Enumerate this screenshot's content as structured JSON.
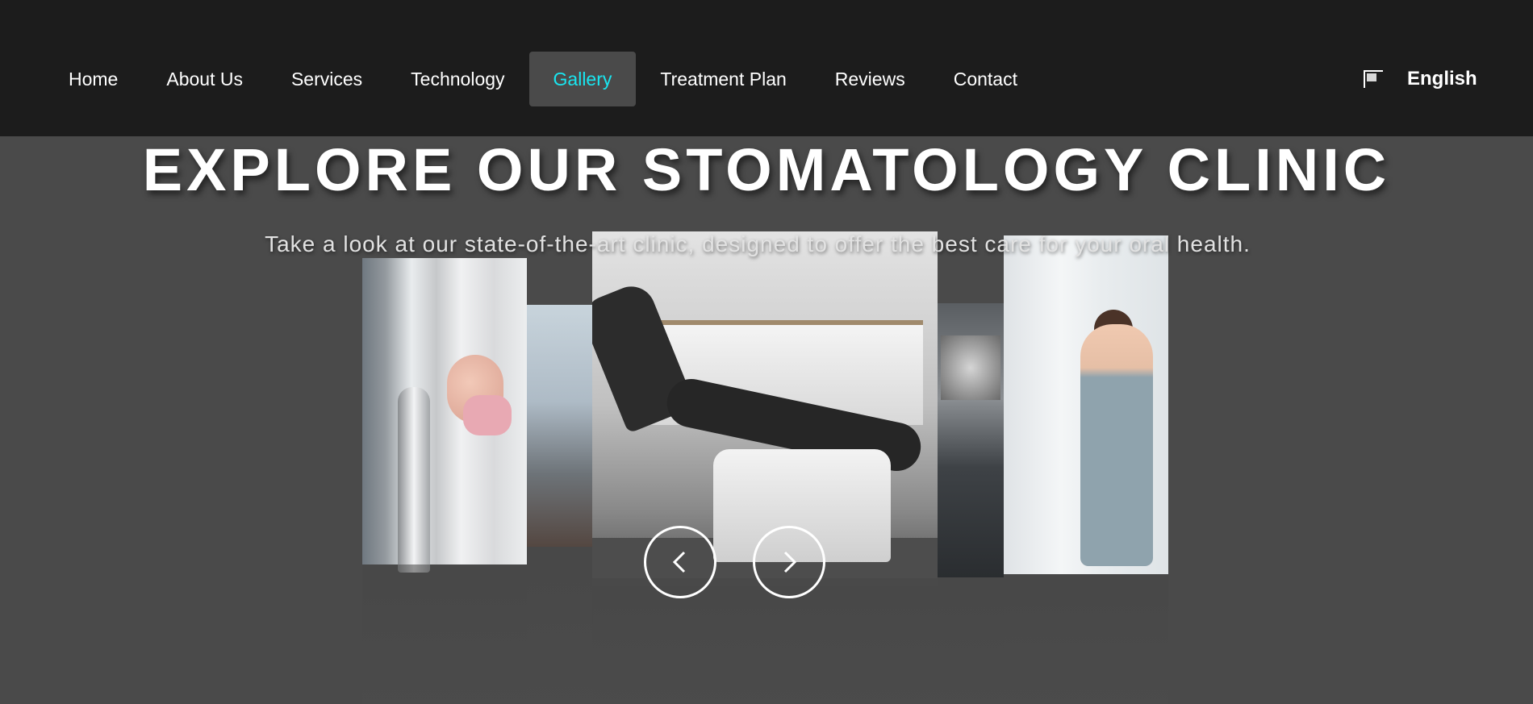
{
  "nav": {
    "items": [
      {
        "label": "Home"
      },
      {
        "label": "About Us"
      },
      {
        "label": "Services"
      },
      {
        "label": "Technology"
      },
      {
        "label": "Gallery",
        "active": true
      },
      {
        "label": "Treatment Plan"
      },
      {
        "label": "Reviews"
      },
      {
        "label": "Contact"
      }
    ],
    "language": {
      "label": "English",
      "icon": "flag-icon"
    }
  },
  "hero": {
    "title": "EXPLORE OUR STOMATOLOGY CLINIC",
    "subtitle": "Take a look at our state-of-the-art clinic, designed to offer the best care for your oral health."
  },
  "carousel": {
    "slides": [
      {
        "name": "dental-equipment-child-photo"
      },
      {
        "name": "dental-light-photo"
      },
      {
        "name": "dental-chair-photo"
      },
      {
        "name": "xray-monitor-photo"
      },
      {
        "name": "dentist-holding-model-photo"
      }
    ],
    "prev_icon": "chevron-left-icon",
    "next_icon": "chevron-right-icon"
  },
  "colors": {
    "nav_bg": "#1c1c1c",
    "page_bg": "#4a4a4a",
    "active_accent": "#19e6f0"
  }
}
